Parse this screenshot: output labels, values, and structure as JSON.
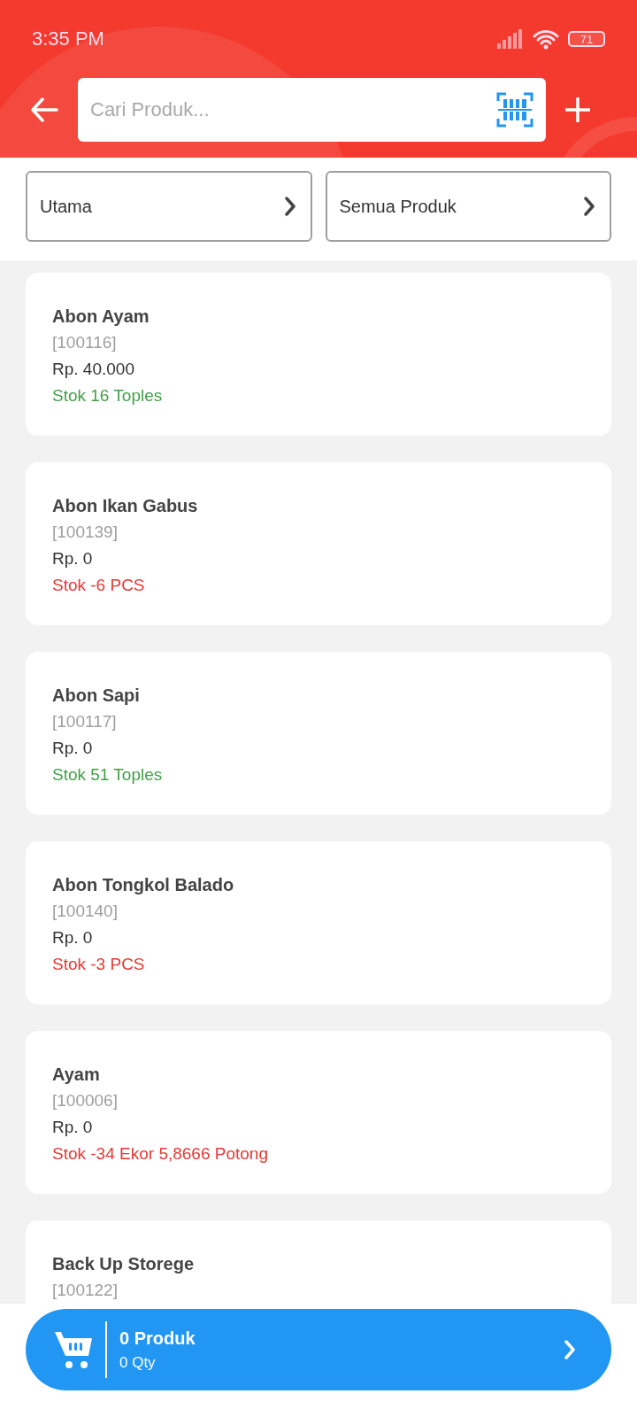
{
  "status_bar": {
    "time": "3:35 PM",
    "battery": "71"
  },
  "search": {
    "placeholder": "Cari Produk..."
  },
  "filters": [
    {
      "label": "Utama"
    },
    {
      "label": "Semua Produk"
    }
  ],
  "products": [
    {
      "name": "Abon Ayam",
      "code": "[100116]",
      "price": "Rp. 40.000",
      "stock": "Stok 16 Toples",
      "color": "#43a047"
    },
    {
      "name": "Abon Ikan Gabus",
      "code": "[100139]",
      "price": "Rp. 0",
      "stock": "Stok -6 PCS",
      "color": "#e53935"
    },
    {
      "name": "Abon Sapi",
      "code": "[100117]",
      "price": "Rp. 0",
      "stock": "Stok 51 Toples",
      "color": "#43a047"
    },
    {
      "name": "Abon Tongkol Balado",
      "code": "[100140]",
      "price": "Rp. 0",
      "stock": "Stok -3 PCS",
      "color": "#e53935"
    },
    {
      "name": "Ayam",
      "code": "[100006]",
      "price": "Rp. 0",
      "stock": "Stok -34 Ekor 5,8666 Potong",
      "color": "#e53935"
    },
    {
      "name": "Back Up Storege",
      "code": "[100122]"
    }
  ],
  "cart": {
    "title": "0 Produk",
    "qty": "0 Qty"
  }
}
